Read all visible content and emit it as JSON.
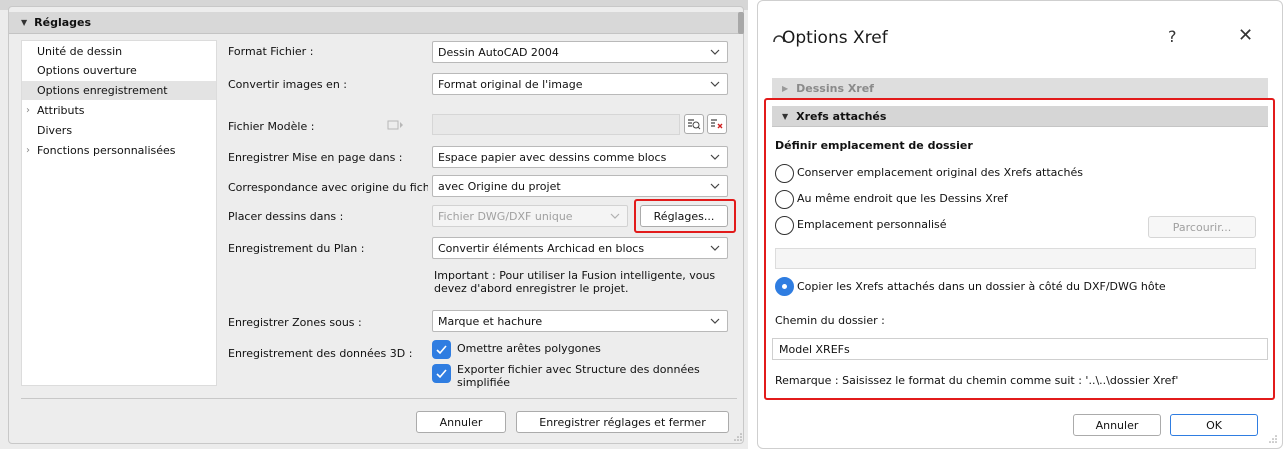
{
  "left": {
    "section_title": "Réglages",
    "tree": [
      {
        "label": "Unité de dessin",
        "selected": false,
        "expandable": false
      },
      {
        "label": "Options ouverture",
        "selected": false,
        "expandable": false
      },
      {
        "label": "Options enregistrement",
        "selected": true,
        "expandable": false
      },
      {
        "label": "Attributs",
        "selected": false,
        "expandable": true
      },
      {
        "label": "Divers",
        "selected": false,
        "expandable": false
      },
      {
        "label": "Fonctions personnalisées",
        "selected": false,
        "expandable": true
      }
    ],
    "rows": {
      "format_label": "Format Fichier :",
      "format_value": "Dessin AutoCAD 2004",
      "convert_label": "Convertir images en :",
      "convert_value": "Format original de l'image",
      "template_label": "Fichier Modèle :",
      "layout_label": "Enregistrer Mise en page dans :",
      "layout_value": "Espace papier avec dessins comme blocs",
      "origin_label": "Correspondance avec origine du fichier",
      "origin_value": "avec Origine du projet",
      "place_label": "Placer dessins dans :",
      "place_value": "Fichier DWG/DXF unique",
      "settings_button": "Réglages...",
      "plan_label": "Enregistrement du Plan :",
      "plan_value": "Convertir éléments Archicad en blocs",
      "note": "Important : Pour utiliser la Fusion intelligente, vous devez d'abord enregistrer le projet.",
      "zones_label": "Enregistrer Zones sous :",
      "zones_value": "Marque et hachure",
      "data3d_label": "Enregistrement des données 3D :",
      "check1": "Omettre arêtes polygones",
      "check2": "Exporter fichier avec Structure des données simplifiée"
    },
    "buttons": {
      "cancel": "Annuler",
      "save": "Enregistrer réglages et fermer"
    }
  },
  "right": {
    "title": "Options Xref",
    "help": "?",
    "close": "✕",
    "sec1": "Dessins Xref",
    "sec2": "Xrefs attachés",
    "folder_heading": "Définir emplacement de dossier",
    "opt1": "Conserver emplacement original des Xrefs attachés",
    "opt2": "Au même endroit que les Dessins Xref",
    "opt3": "Emplacement personnalisé",
    "browse": "Parcourir...",
    "opt4": "Copier les Xrefs attachés dans un dossier à côté du DXF/DWG hôte",
    "path_label": "Chemin du dossier :",
    "path_value": "Model XREFs",
    "remark": "Remarque : Saisissez le format du chemin comme suit :   '..\\..\\dossier Xref'",
    "cancel": "Annuler",
    "ok": "OK",
    "selected_option": 4
  },
  "colors": {
    "accent": "#2f7de1",
    "highlight": "#e21b1b"
  }
}
